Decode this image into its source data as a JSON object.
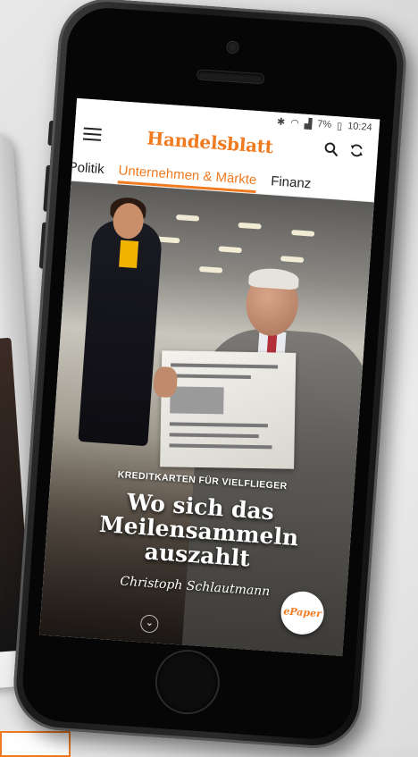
{
  "status_bar": {
    "icons": [
      "bluetooth-icon",
      "wifi-icon",
      "signal-icon"
    ],
    "battery": "7%",
    "battery_icon": "battery-icon",
    "time": "10:24"
  },
  "app_bar": {
    "menu_icon": "hamburger-menu-icon",
    "brand": "Handelsblatt",
    "search_icon": "search-icon",
    "refresh_icon": "refresh-icon"
  },
  "tabs": [
    {
      "label": "Politik"
    },
    {
      "label": "Unternehmen & Märkte",
      "active": true
    },
    {
      "label": "Finanz"
    }
  ],
  "article": {
    "kicker": "KREDITKARTEN FÜR VIELFLIEGER",
    "headline_lines": [
      "Wo sich das",
      "Meilensammeln",
      "auszahlt"
    ],
    "author": "Christoph Schlautmann",
    "scroll_icon": "chevron-down-icon"
  },
  "epaper_button": {
    "label": "ePaper"
  },
  "colors": {
    "accent": "#f07a20",
    "text_dark": "#222222",
    "background": "#ffffff"
  }
}
